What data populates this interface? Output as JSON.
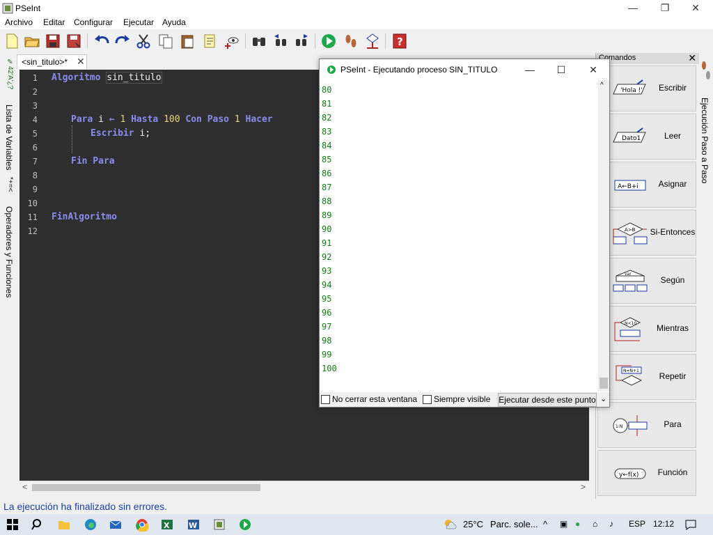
{
  "window": {
    "title": "PSeInt",
    "controls": [
      "—",
      "❐",
      "✕"
    ]
  },
  "menu": [
    "Archivo",
    "Editar",
    "Configurar",
    "Ejecutar",
    "Ayuda"
  ],
  "left_tabs": {
    "variables": "Lista de Variables",
    "operators": "Operadores y Funciones"
  },
  "document_tab": {
    "label": "<sin_titulo>*",
    "close": "✕"
  },
  "editor": {
    "line_numbers": [
      "1",
      "2",
      "3",
      "4",
      "5",
      "6",
      "7",
      "8",
      "9",
      "10",
      "11",
      "12"
    ],
    "code": {
      "line1_kw": "Algoritmo",
      "line1_name": "sin_titulo",
      "line4_para": "Para",
      "line4_var": "i",
      "line4_arrow": "←",
      "line4_start": "1",
      "line4_hasta": "Hasta",
      "line4_end": "100",
      "line4_con": "Con Paso",
      "line4_step": "1",
      "line4_hacer": "Hacer",
      "line5_kw": "Escribir",
      "line5_arg": "i;",
      "line7_kw": "Fin Para",
      "line11_kw": "FinAlgoritmo"
    }
  },
  "status": "La ejecución ha finalizado sin errores.",
  "commands": {
    "header": "Comandos",
    "close": "✕",
    "items": [
      {
        "label": "Escribir",
        "icon_text": "'Hola !'"
      },
      {
        "label": "Leer",
        "icon_text": "Dato1"
      },
      {
        "label": "Asignar",
        "icon_text": "A←B+i"
      },
      {
        "label": "Si-Entonces",
        "icon_text": "A>B"
      },
      {
        "label": "Según",
        "icon_text": "var"
      },
      {
        "label": "Mientras",
        "icon_text": "N<10"
      },
      {
        "label": "Repetir",
        "icon_text": "N=N+1"
      },
      {
        "label": "Para",
        "icon_text": "1:N"
      },
      {
        "label": "Función",
        "icon_text": "y←f(x)"
      }
    ]
  },
  "right_tab": "Ejecución Paso a Paso",
  "run_window": {
    "title": "PSeInt - Ejecutando proceso SIN_TITULO",
    "output": [
      "80",
      "81",
      "82",
      "83",
      "84",
      "85",
      "86",
      "87",
      "88",
      "89",
      "90",
      "91",
      "92",
      "93",
      "94",
      "95",
      "96",
      "97",
      "98",
      "99",
      "100"
    ],
    "no_close_label": "No cerrar esta ventana",
    "always_visible_label": "Siempre visible",
    "exec_button": "Ejecutar desde este punto"
  },
  "taskbar": {
    "weather": "25°C",
    "weather_desc": "Parc. sole...",
    "lang": "ESP",
    "time": "12:12"
  },
  "colors": {
    "editor_bg": "#2f2f2f",
    "keyword": "#8c8cf0",
    "number": "#e8d87c",
    "output": "#147c14",
    "status": "#1a3ea5"
  }
}
